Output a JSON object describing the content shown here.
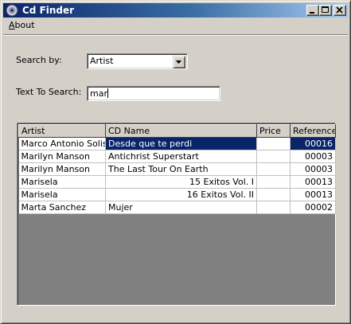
{
  "window": {
    "title": "Cd Finder"
  },
  "menu": [
    {
      "label": "About",
      "mnemonic": "A"
    }
  ],
  "search": {
    "by_label": "Search by:",
    "by_value": "Artist",
    "text_label": "Text To Search:",
    "text_value": "mar"
  },
  "grid": {
    "columns": [
      "Artist",
      "CD Name",
      "Price",
      "Reference"
    ],
    "selected_row": 0,
    "rows": [
      {
        "artist": "Marco Antonio Solis",
        "cd": "Desde que te perdi",
        "cd_align": "left",
        "price": "",
        "reference": "00016"
      },
      {
        "artist": "Marilyn Manson",
        "cd": "Antichrist Superstart",
        "cd_align": "left",
        "price": "",
        "reference": "00003"
      },
      {
        "artist": "Marilyn Manson",
        "cd": "The Last Tour On Earth",
        "cd_align": "left",
        "price": "",
        "reference": "00003"
      },
      {
        "artist": "Marisela",
        "cd": "15 Exitos Vol. I",
        "cd_align": "right",
        "price": "",
        "reference": "00013"
      },
      {
        "artist": "Marisela",
        "cd": "16 Exitos Vol. II",
        "cd_align": "right",
        "price": "",
        "reference": "00013"
      },
      {
        "artist": "Marta Sanchez",
        "cd": "Mujer",
        "cd_align": "left",
        "price": "",
        "reference": "00002"
      }
    ]
  },
  "colors": {
    "title_gradient_start": "#0a246a",
    "title_gradient_end": "#a6caf0",
    "selection": "#0a246a",
    "grid_empty_area": "#808080"
  },
  "icons": [
    "cd-disc-icon",
    "minimize-icon",
    "maximize-icon",
    "close-icon",
    "dropdown-arrow-icon"
  ]
}
